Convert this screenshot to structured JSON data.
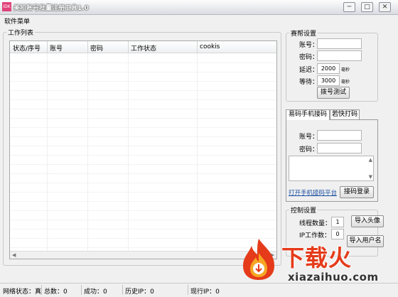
{
  "window": {
    "title": "美拍账号批量注册工具1.0",
    "icon_text": "IDK",
    "controls": [
      "─",
      "□",
      "✕"
    ]
  },
  "menu": {
    "items": [
      "软件菜单"
    ]
  },
  "work_list": {
    "legend": "工作列表",
    "columns": [
      "状态/序号",
      "账号",
      "密码",
      "工作状态",
      "cookis"
    ],
    "rows": []
  },
  "proxy_settings": {
    "legend": "赛帮设置",
    "account_label": "账号：",
    "account_value": "",
    "password_label": "密码：",
    "password_value": "",
    "delay_label": "延迟：",
    "delay_value": "2000",
    "delay_unit": "毫秒",
    "wait_label": "等待：",
    "wait_value": "3000",
    "wait_unit": "毫秒",
    "dial_test_button": "拨号测试"
  },
  "captcha_tabs": {
    "tabs": [
      "易码手机接码",
      "若快打码"
    ],
    "active": 0,
    "account_label": "账号：",
    "account_value": "",
    "password_label": "密码：",
    "password_value": "",
    "open_platform_link": "打开手机接码平台",
    "login_button": "接码登录"
  },
  "control_settings": {
    "legend": "控制设置",
    "thread_count_label": "线程数量：",
    "thread_count_value": "1",
    "ip_work_count_label": "IP工作数：",
    "ip_work_count_value": "0",
    "import_avatar_button": "导入头像",
    "import_username_button": "导入用户名"
  },
  "status_bar": {
    "network_status": "网络状态：真",
    "total": "总数：0",
    "success": "成功：0",
    "history_ip": "历史IP：0",
    "current_ip": "现行IP：0"
  },
  "watermark": {
    "brand": "下载火",
    "url": "xiazaihuo.com",
    "colors": {
      "flame": "#e53b1a",
      "accent": "#f6a623"
    }
  },
  "colors": {
    "link": "#1a4ea0",
    "window_bg": "#f0f0f0"
  }
}
